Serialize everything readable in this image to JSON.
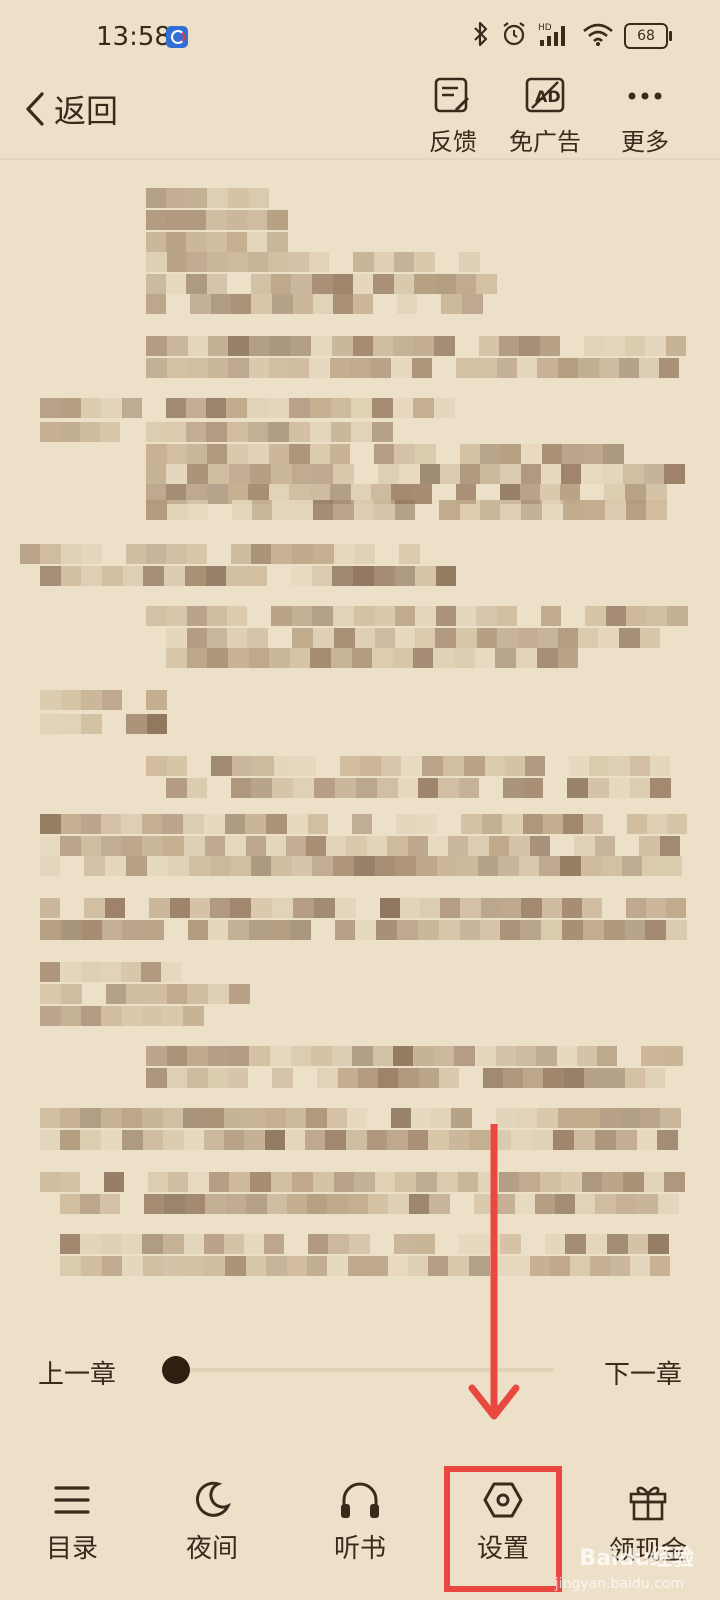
{
  "status_bar": {
    "time": "13:58",
    "battery": "68",
    "network_label": "HD",
    "icons": [
      "bluetooth-icon",
      "alarm-icon",
      "signal-icon",
      "wifi-icon",
      "battery-icon"
    ]
  },
  "header": {
    "back_label": "返回",
    "actions": [
      {
        "label": "反馈",
        "icon": "feedback-icon"
      },
      {
        "label": "免广告",
        "icon": "no-ads-icon"
      },
      {
        "label": "更多",
        "icon": "more-icon"
      }
    ]
  },
  "content": {
    "state": "blurred-mosaic"
  },
  "chapter_nav": {
    "prev_label": "上一章",
    "next_label": "下一章",
    "progress": 0.0
  },
  "toolbar": {
    "items": [
      {
        "label": "目录",
        "icon": "menu-list-icon"
      },
      {
        "label": "夜间",
        "icon": "moon-icon"
      },
      {
        "label": "听书",
        "icon": "headphones-icon"
      },
      {
        "label": "设置",
        "icon": "settings-icon"
      },
      {
        "label": "领现金",
        "icon": "gift-icon"
      }
    ]
  },
  "watermark": {
    "text": "Baidu经验",
    "sub": "jingyan.baidu.com"
  },
  "colors": {
    "background": "#ede0c8",
    "text": "#3a2a1c",
    "annotation": "#e8483f"
  }
}
